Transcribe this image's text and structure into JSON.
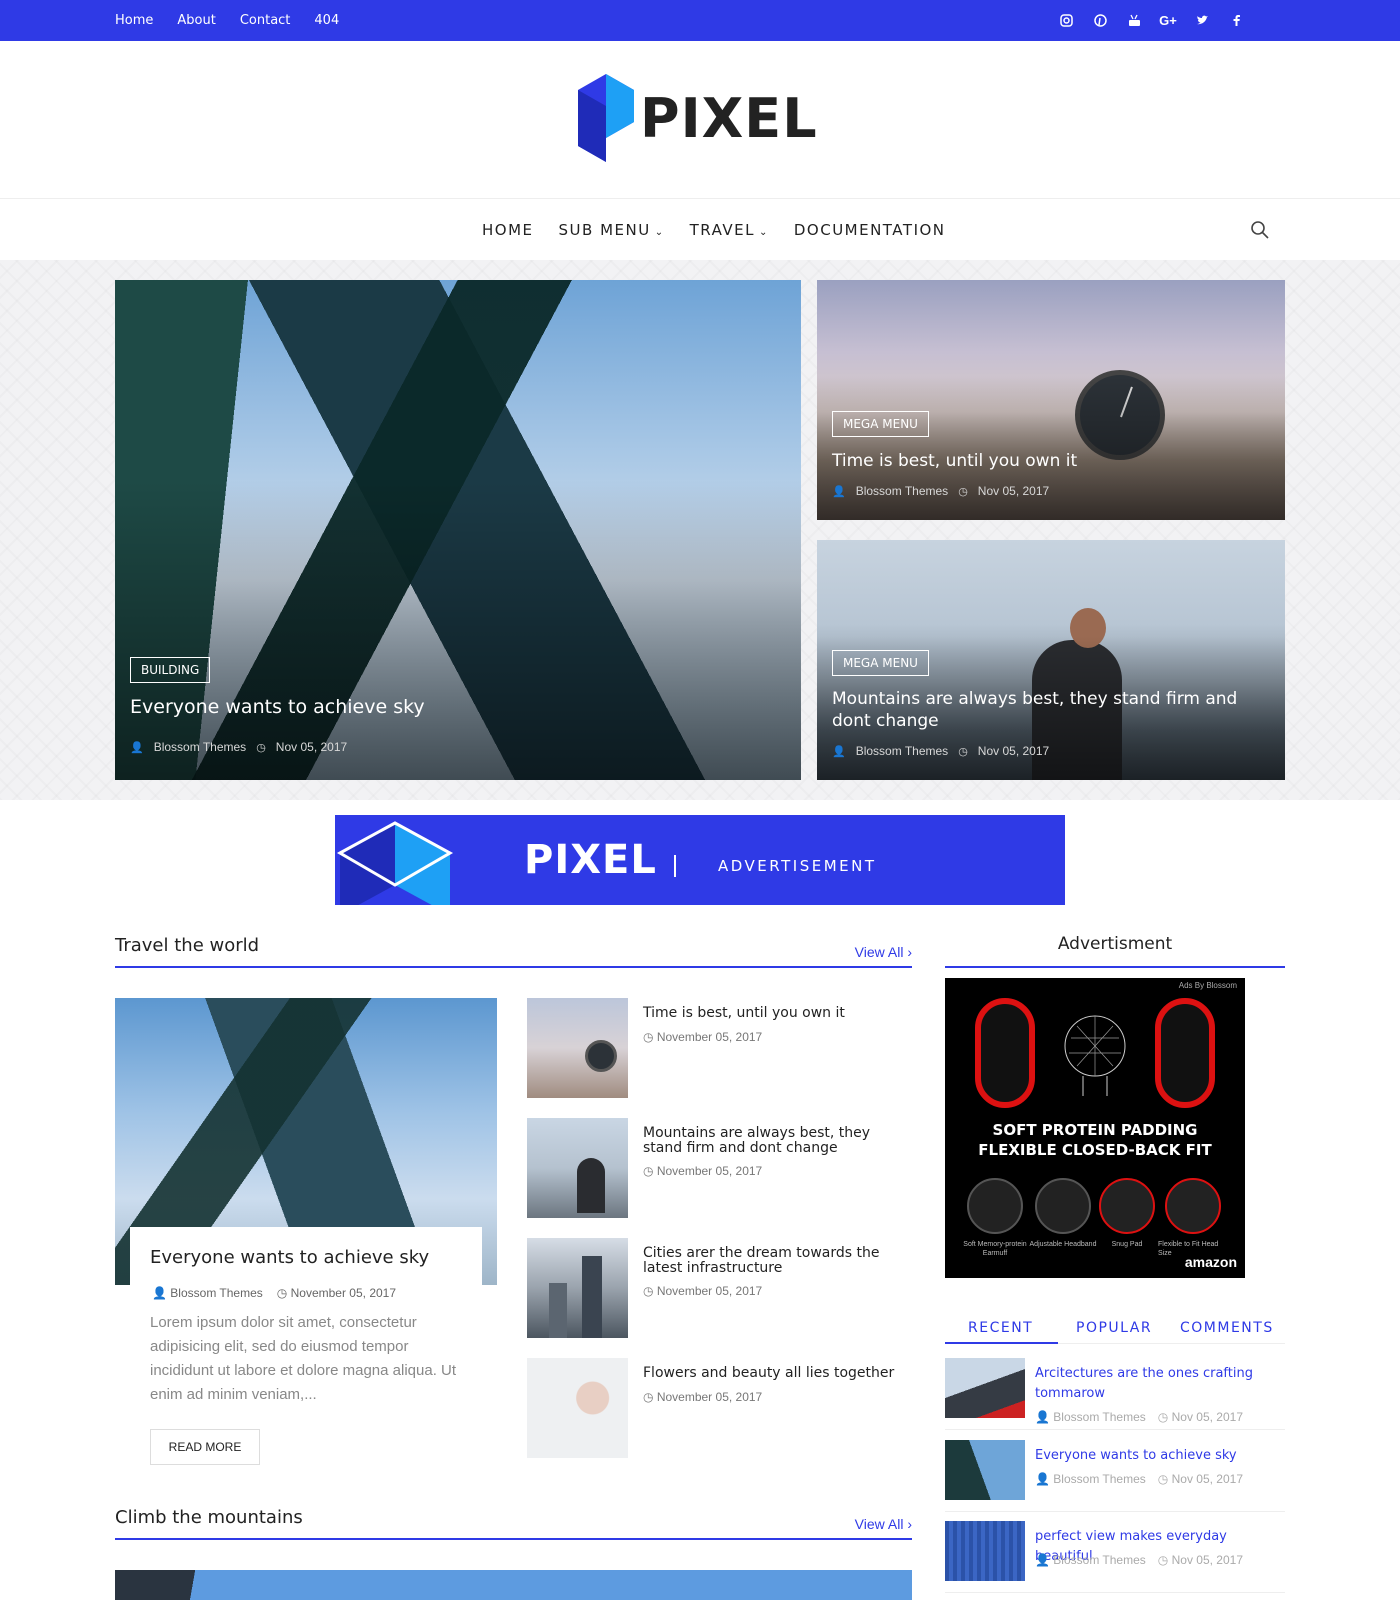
{
  "topbar": {
    "links": [
      "Home",
      "About",
      "Contact",
      "404"
    ],
    "social_icons": [
      "instagram-icon",
      "pinterest-icon",
      "youtube-icon",
      "google-plus-icon",
      "twitter-icon",
      "facebook-icon"
    ]
  },
  "logo": {
    "text": "PIXEL"
  },
  "nav": {
    "items": [
      "HOME",
      "SUB MENU",
      "TRAVEL",
      "DOCUMENTATION"
    ],
    "search_icon": "search-icon"
  },
  "hero": {
    "main": {
      "tag": "BUILDING",
      "title": "Everyone wants to achieve sky",
      "author": "Blossom Themes",
      "date": "Nov 05, 2017"
    },
    "right1": {
      "tag": "MEGA MENU",
      "title": "Time is best, until you own it",
      "author": "Blossom Themes",
      "date": "Nov 05, 2017"
    },
    "right2": {
      "tag": "MEGA MENU",
      "title": "Mountains are always best, they stand firm and dont change",
      "author": "Blossom Themes",
      "date": "Nov 05, 2017"
    }
  },
  "ad_banner": {
    "word": "PIXEL",
    "label": "ADVERTISEMENT"
  },
  "section_travel": {
    "title": "Travel the world",
    "view_all": "View All",
    "featured": {
      "title": "Everyone wants to achieve sky",
      "author": "Blossom Themes",
      "date": "November 05, 2017",
      "excerpt": "Lorem ipsum dolor sit amet, consectetur adipisicing elit, sed do eiusmod tempor incididunt ut labore et dolore magna aliqua. Ut enim ad minim veniam,...",
      "read_more": "READ MORE"
    },
    "posts": [
      {
        "title": "Time is best, until you own it",
        "date": "November 05, 2017"
      },
      {
        "title": "Mountains are always best, they stand firm and dont change",
        "date": "November 05, 2017"
      },
      {
        "title": "Cities arer the dream towards the latest infrastructure",
        "date": "November 05, 2017"
      },
      {
        "title": "Flowers and beauty all lies together",
        "date": "November 05, 2017"
      }
    ]
  },
  "section_mountains": {
    "title": "Climb the mountains",
    "view_all": "View All"
  },
  "sidebar": {
    "ad_title": "Advertisment",
    "ad": {
      "ads_by": "Ads By Blossom",
      "headline_1": "SOFT PROTEIN PADDING",
      "headline_2": "FLEXIBLE CLOSED-BACK FIT",
      "features": [
        "Soft Memory-protein Earmuff",
        "Adjustable Headband",
        "Snug Pad",
        "Flexible to Fit Head Size"
      ],
      "brand": "amazon"
    },
    "tabs": [
      "RECENT",
      "POPULAR",
      "COMMENTS"
    ],
    "recent": [
      {
        "title": "Arcitectures are the ones crafting tommarow",
        "author": "Blossom Themes",
        "date": "Nov 05, 2017"
      },
      {
        "title": "Everyone wants to achieve sky",
        "author": "Blossom Themes",
        "date": "Nov 05, 2017"
      },
      {
        "title": "perfect view makes everyday beautiful",
        "author": "Blossom Themes",
        "date": "Nov 05, 2017"
      }
    ]
  },
  "colors": {
    "accent": "#2f3ae6",
    "logo_light": "#1ea0f5"
  }
}
